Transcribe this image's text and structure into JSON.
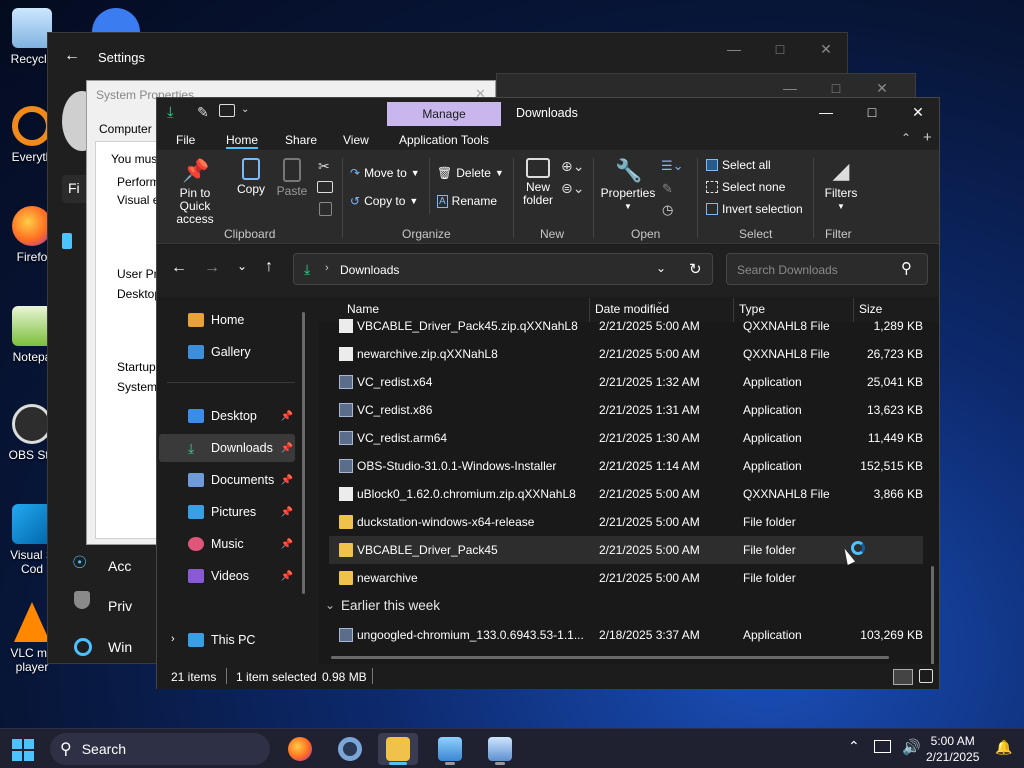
{
  "desktop": {
    "icons": [
      {
        "label": "Recycle",
        "icon": "recycle-bin-icon"
      },
      {
        "label": "Everyth",
        "icon": "everything-search-icon"
      },
      {
        "label": "Firefo",
        "icon": "firefox-icon"
      },
      {
        "label": "Notepa",
        "icon": "notepad-icon"
      },
      {
        "label": "OBS Stu",
        "icon": "obs-icon"
      },
      {
        "label": "Visual S",
        "icon": "vscode-icon"
      },
      {
        "label": "Cod",
        "icon": "vscode-icon"
      },
      {
        "label": "VLC me",
        "icon": "vlc-icon"
      },
      {
        "label": "player",
        "icon": "vlc-icon"
      }
    ]
  },
  "settings": {
    "title": "Settings",
    "sidebar_items": [
      "Acc",
      "Priv",
      "Win"
    ],
    "find_text": "Fi"
  },
  "system_properties": {
    "title": "System Properties",
    "tab": "Computer N",
    "must_text": "You must",
    "performance_label": "Performa",
    "visual_label": "Visual ef",
    "user_profiles_label": "User Pro",
    "desktop_label": "Desktop",
    "startup_label": "Startup a",
    "system_label": "System s"
  },
  "explorer": {
    "manage_tab": "Manage",
    "window_title": "Downloads",
    "menu": [
      "File",
      "Home",
      "Share",
      "View",
      "Application Tools"
    ],
    "active_menu": "Home",
    "ribbon": {
      "pin_label": "Pin to Quick access",
      "copy_label": "Copy",
      "paste_label": "Paste",
      "move_to": "Move to",
      "copy_to": "Copy to",
      "delete": "Delete",
      "rename": "Rename",
      "new_folder": "New folder",
      "properties": "Properties",
      "select_all": "Select all",
      "select_none": "Select none",
      "invert_selection": "Invert selection",
      "filters": "Filters",
      "groups": [
        "Clipboard",
        "Organize",
        "New",
        "Open",
        "Select",
        "Filter"
      ]
    },
    "address": "Downloads",
    "search_placeholder": "Search Downloads",
    "sidebar": [
      {
        "label": "Home",
        "icon": "home-icon",
        "pinned": false
      },
      {
        "label": "Gallery",
        "icon": "gallery-icon",
        "pinned": false
      },
      {
        "label": "Desktop",
        "icon": "desktop-icon",
        "pinned": true
      },
      {
        "label": "Downloads",
        "icon": "downloads-icon",
        "pinned": true
      },
      {
        "label": "Documents",
        "icon": "documents-icon",
        "pinned": true
      },
      {
        "label": "Pictures",
        "icon": "pictures-icon",
        "pinned": true
      },
      {
        "label": "Music",
        "icon": "music-icon",
        "pinned": true
      },
      {
        "label": "Videos",
        "icon": "videos-icon",
        "pinned": true
      },
      {
        "label": "This PC",
        "icon": "pc-icon",
        "pinned": false
      }
    ],
    "columns": [
      "Name",
      "Date modified",
      "Type",
      "Size"
    ],
    "files": [
      {
        "name": "VBCABLE_Driver_Pack45.zip.qXXNahL8",
        "date": "2/21/2025 5:00 AM",
        "type": "QXXNAHL8 File",
        "size": "1,289 KB",
        "kind": "doc"
      },
      {
        "name": "newarchive.zip.qXXNahL8",
        "date": "2/21/2025 5:00 AM",
        "type": "QXXNAHL8 File",
        "size": "26,723 KB",
        "kind": "doc"
      },
      {
        "name": "VC_redist.x64",
        "date": "2/21/2025 1:32 AM",
        "type": "Application",
        "size": "25,041 KB",
        "kind": "app"
      },
      {
        "name": "VC_redist.x86",
        "date": "2/21/2025 1:31 AM",
        "type": "Application",
        "size": "13,623 KB",
        "kind": "app"
      },
      {
        "name": "VC_redist.arm64",
        "date": "2/21/2025 1:30 AM",
        "type": "Application",
        "size": "11,449 KB",
        "kind": "app"
      },
      {
        "name": "OBS-Studio-31.0.1-Windows-Installer",
        "date": "2/21/2025 1:14 AM",
        "type": "Application",
        "size": "152,515 KB",
        "kind": "app"
      },
      {
        "name": "uBlock0_1.62.0.chromium.zip.qXXNahL8",
        "date": "2/21/2025 5:00 AM",
        "type": "QXXNAHL8 File",
        "size": "3,866 KB",
        "kind": "doc"
      },
      {
        "name": "duckstation-windows-x64-release",
        "date": "2/21/2025 5:00 AM",
        "type": "File folder",
        "size": "",
        "kind": "folder"
      },
      {
        "name": "VBCABLE_Driver_Pack45",
        "date": "2/21/2025 5:00 AM",
        "type": "File folder",
        "size": "",
        "kind": "folder"
      },
      {
        "name": "newarchive",
        "date": "2/21/2025 5:00 AM",
        "type": "File folder",
        "size": "",
        "kind": "folder"
      }
    ],
    "group_header": "Earlier this week",
    "earlier_files": [
      {
        "name": "ungoogled-chromium_133.0.6943.53-1.1...",
        "date": "2/18/2025 3:37 AM",
        "type": "Application",
        "size": "103,269 KB",
        "kind": "app"
      }
    ],
    "status": {
      "items": "21 items",
      "selected": "1 item selected",
      "size": "0.98 MB"
    }
  },
  "taskbar": {
    "search_label": "Search",
    "time": "5:00 AM",
    "date": "2/21/2025"
  },
  "colors": {
    "accent": "#4cc2ff",
    "manage_tab": "#c9b6ec",
    "folder": "#f0c24a"
  }
}
